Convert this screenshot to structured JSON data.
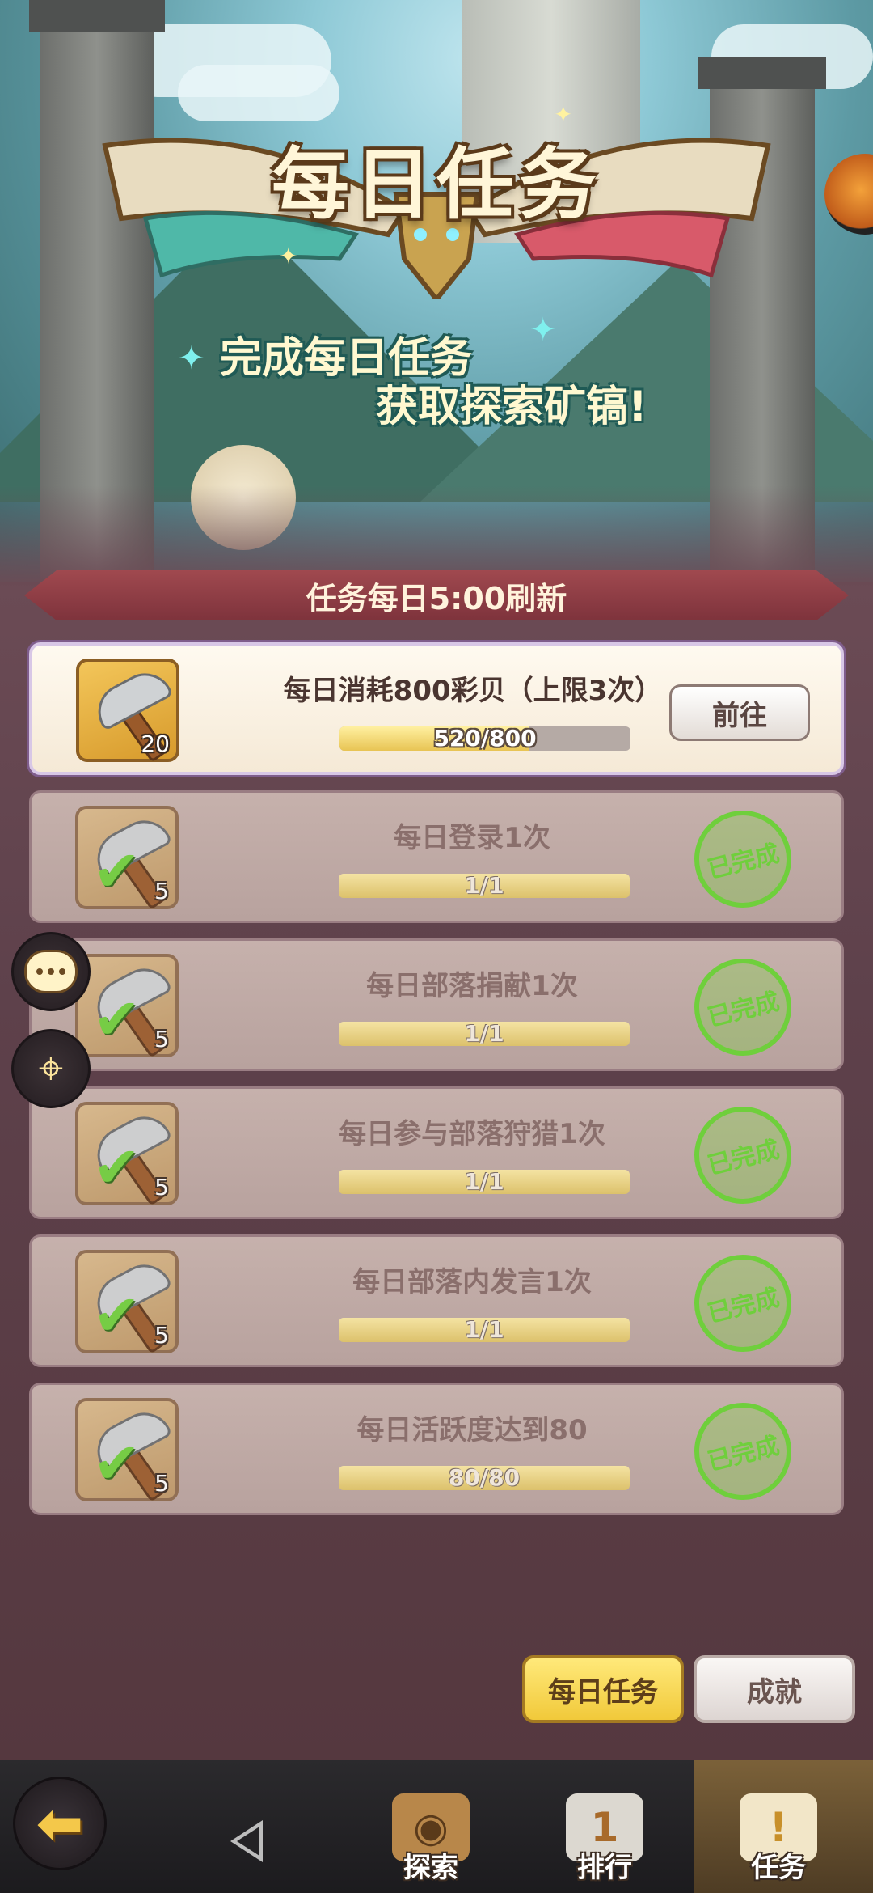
{
  "banner": {
    "title": "每日任务",
    "subtitle_line1": "完成每日任务",
    "subtitle_line2": "获取探索矿镐!"
  },
  "refresh_notice": "任务每日5:00刷新",
  "tasks": [
    {
      "title": "每日消耗800彩贝（上限3次）",
      "reward_count": "20",
      "progress_text": "520/800",
      "progress": 0.65,
      "status": "active",
      "action_label": "前往"
    },
    {
      "title": "每日登录1次",
      "reward_count": "5",
      "progress_text": "1/1",
      "progress": 1.0,
      "status": "done",
      "stamp_label": "已完成"
    },
    {
      "title": "每日部落捐献1次",
      "reward_count": "5",
      "progress_text": "1/1",
      "progress": 1.0,
      "status": "done",
      "stamp_label": "已完成"
    },
    {
      "title": "每日参与部落狩猎1次",
      "reward_count": "5",
      "progress_text": "1/1",
      "progress": 1.0,
      "status": "done",
      "stamp_label": "已完成"
    },
    {
      "title": "每日部落内发言1次",
      "reward_count": "5",
      "progress_text": "1/1",
      "progress": 1.0,
      "status": "done",
      "stamp_label": "已完成"
    },
    {
      "title": "每日活跃度达到80",
      "reward_count": "5",
      "progress_text": "80/80",
      "progress": 1.0,
      "status": "done",
      "stamp_label": "已完成"
    }
  ],
  "tabs": {
    "daily": "每日任务",
    "achievements": "成就"
  },
  "nav": {
    "explore": "探索",
    "ranking": "排行",
    "tasks": "任务"
  },
  "colors": {
    "accent_yellow": "#f1c93a",
    "done_green": "#6fcf3c",
    "ribbon_red": "#8e3d45"
  }
}
